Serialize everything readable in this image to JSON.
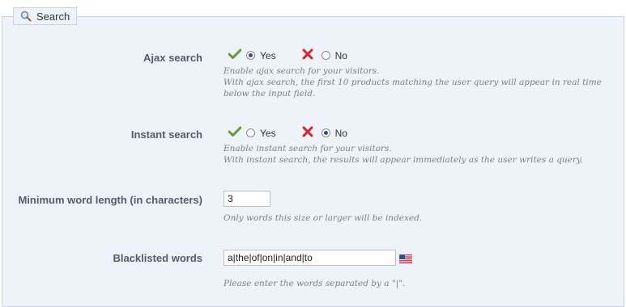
{
  "section": {
    "title": "Search",
    "icon": "magnifier-icon"
  },
  "ajax": {
    "label": "Ajax search",
    "yes_label": "Yes",
    "no_label": "No",
    "selected": "yes",
    "help_line1": "Enable ajax search for your visitors.",
    "help_line2": "With ajax search, the first 10 products matching the user query will appear in real time",
    "help_line3": "below the input field."
  },
  "instant": {
    "label": "Instant search",
    "yes_label": "Yes",
    "no_label": "No",
    "selected": "no",
    "help_line1": "Enable instant search for your visitors.",
    "help_line2": "With instant search, the results will appear immediately as the user writes a query."
  },
  "min_word": {
    "label": "Minimum word length (in characters)",
    "value": "3",
    "help": "Only words this size or larger will be indexed."
  },
  "blacklist": {
    "label": "Blacklisted words",
    "value": "a|the|of|on|in|and|to",
    "help": "Please enter the words separated by a \"|\"."
  },
  "colors": {
    "check": "#5aa02c",
    "cross": "#d9242b",
    "panel_bg": "#eef2f9",
    "label": "#585a69"
  }
}
